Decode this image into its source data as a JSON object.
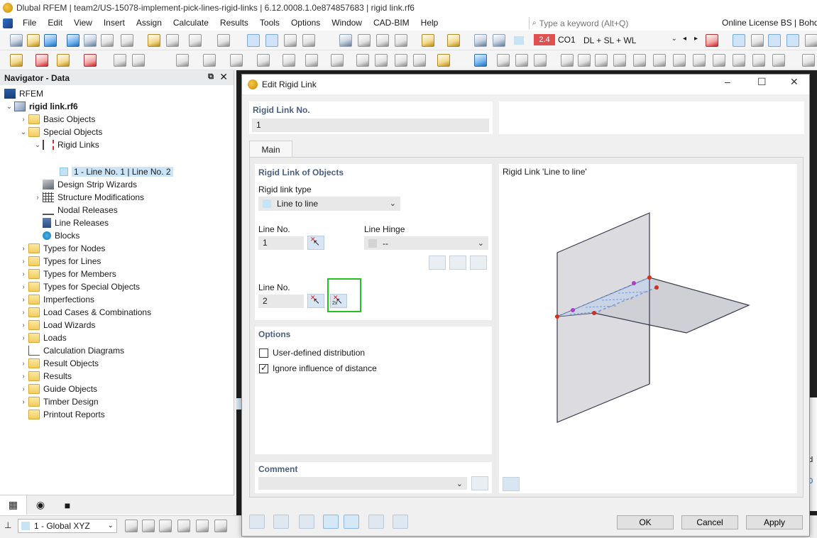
{
  "window": {
    "title": "Dlubal RFEM | team2/US-15078-implement-pick-lines-rigid-links | 6.12.0008.1.0e874857683 | rigid link.rf6"
  },
  "menu": {
    "items": [
      "File",
      "Edit",
      "View",
      "Insert",
      "Assign",
      "Calculate",
      "Results",
      "Tools",
      "Options",
      "Window",
      "CAD-BIM",
      "Help"
    ],
    "search_placeholder": "Type a keyword (Alt+Q)",
    "license": "Online License BS | Bohdan"
  },
  "toolbar": {
    "load_case_code": "2.4",
    "load_case_name": "CO1",
    "load_combination": "DL + SL + WL"
  },
  "navigator": {
    "title": "Navigator - Data",
    "root": "RFEM",
    "model": "rigid link.rf6",
    "items": [
      "Basic Objects",
      "Special Objects",
      "Rigid Links",
      "1 - Line No. 1 | Line No. 2",
      "Design Strip Wizards",
      "Structure Modifications",
      "Nodal Releases",
      "Line Releases",
      "Blocks",
      "Types for Nodes",
      "Types for Lines",
      "Types for Members",
      "Types for Special Objects",
      "Imperfections",
      "Load Cases & Combinations",
      "Load Wizards",
      "Loads",
      "Calculation Diagrams",
      "Result Objects",
      "Results",
      "Guide Objects",
      "Timber Design",
      "Printout Reports"
    ]
  },
  "status": {
    "coord_system": "1 - Global XYZ"
  },
  "dialog": {
    "title": "Edit Rigid Link",
    "no_label": "Rigid Link No.",
    "no_value": "1",
    "tab_main": "Main",
    "objects_title": "Rigid Link of Objects",
    "type_label": "Rigid link type",
    "type_value": "Line to line",
    "line1_label": "Line No.",
    "line1_value": "1",
    "hinge_label": "Line Hinge",
    "hinge_value": "--",
    "line2_label": "Line No.",
    "line2_value": "2",
    "pick2x_label": "2x",
    "options_title": "Options",
    "opt_user_defined": "User-defined distribution",
    "opt_user_defined_checked": false,
    "opt_ignore_distance": "Ignore influence of distance",
    "opt_ignore_distance_checked": true,
    "comment_label": "Comment",
    "comment_value": "",
    "preview_title": "Rigid Link 'Line to line'",
    "ok": "OK",
    "cancel": "Cancel",
    "apply": "Apply"
  },
  "colors": {
    "panel_title": "#4a5f7f",
    "highlight_green": "#22c322",
    "load_case_red": "#e05050",
    "node_red": "#d2301a",
    "node_purple": "#b03cc8",
    "link_blue": "#7b9ad6"
  }
}
